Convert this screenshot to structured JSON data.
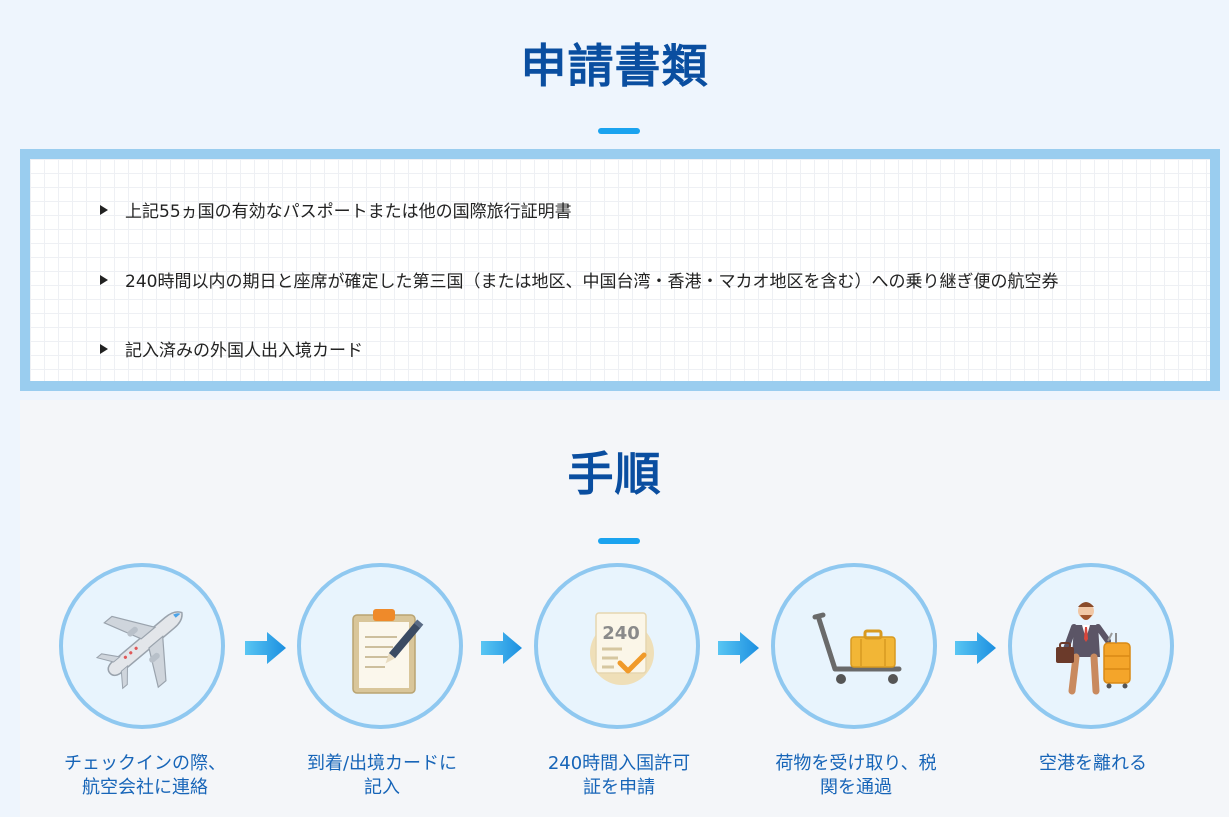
{
  "documents": {
    "title": "申請書類",
    "items": [
      "上記55ヵ国の有効なパスポートまたは他の国際旅行証明書",
      "240時間以内の期日と座席が確定した第三国（または地区、中国台湾・香港・マカオ地区を含む）への乗り継ぎ便の航空券",
      "記入済みの外国人出入境カード"
    ]
  },
  "procedure": {
    "title": "手順",
    "steps": [
      {
        "label": "チェックインの際、\n航空会社に連絡",
        "icon": "airplane-icon"
      },
      {
        "label": "到着/出境カードに\n記入",
        "icon": "clipboard-pen-icon"
      },
      {
        "label": "240時間入国許可\n証を申請",
        "icon": "permit-240-icon",
        "badge": "240"
      },
      {
        "label": "荷物を受け取り、税\n関を通過",
        "icon": "luggage-cart-icon"
      },
      {
        "label": "空港を離れる",
        "icon": "traveler-icon"
      }
    ]
  },
  "colors": {
    "title": "#0a4ea0",
    "accent": "#1aa3ef",
    "circle_border": "#8fc8f0",
    "label": "#1765b8"
  }
}
